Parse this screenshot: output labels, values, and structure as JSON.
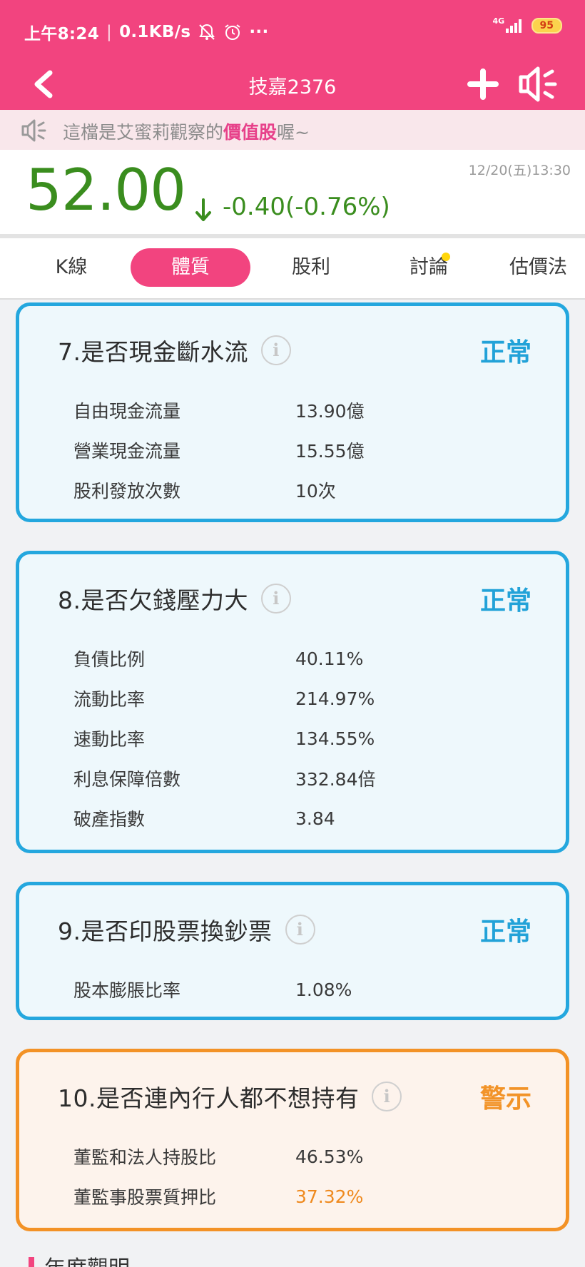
{
  "status_bar": {
    "time": "上午8:24",
    "speed": "0.1KB/s",
    "more": "···",
    "network": "4G",
    "battery": "95"
  },
  "nav": {
    "title": "技嘉2376"
  },
  "announce": {
    "prefix": "這檔是艾蜜莉觀察的",
    "highlight": "價值股",
    "suffix": "喔~"
  },
  "quote": {
    "price": "52.00",
    "change": "-0.40(-0.76%)",
    "datetime": "12/20(五)13:30"
  },
  "tabs": [
    {
      "label": "K線"
    },
    {
      "label": "體質"
    },
    {
      "label": "股利"
    },
    {
      "label": "討論"
    },
    {
      "label": "估價法"
    }
  ],
  "cards": [
    {
      "title": "7.是否現金斷水流",
      "status": "正常",
      "rows": [
        {
          "label": "自由現金流量",
          "value": "13.90億"
        },
        {
          "label": "營業現金流量",
          "value": "15.55億"
        },
        {
          "label": "股利發放次數",
          "value": "10次"
        }
      ]
    },
    {
      "title": "8.是否欠錢壓力大",
      "status": "正常",
      "rows": [
        {
          "label": "負債比例",
          "value": "40.11%"
        },
        {
          "label": "流動比率",
          "value": "214.97%"
        },
        {
          "label": "速動比率",
          "value": "134.55%"
        },
        {
          "label": "利息保障倍數",
          "value": "332.84倍"
        },
        {
          "label": "破產指數",
          "value": "3.84"
        }
      ]
    },
    {
      "title": "9.是否印股票換鈔票",
      "status": "正常",
      "rows": [
        {
          "label": "股本膨脹比率",
          "value": "1.08%"
        }
      ]
    },
    {
      "title": "10.是否連內行人都不想持有",
      "status": "警示",
      "rows": [
        {
          "label": "董監和法人持股比",
          "value": "46.53%"
        },
        {
          "label": "董監事股票質押比",
          "value": "37.32%"
        }
      ]
    }
  ],
  "section_peek": {
    "title": "年度觀明"
  },
  "colors": {
    "brand_pink": "#f2447f",
    "price_green": "#3a8d1e",
    "normal_blue": "#24a7de",
    "warn_orange": "#f39226"
  },
  "icons": [
    "back-icon",
    "add-icon",
    "speaker-icon",
    "info-icon",
    "arrow-down-icon",
    "mute-icon",
    "alarm-icon",
    "signal-icon",
    "battery-icon"
  ]
}
